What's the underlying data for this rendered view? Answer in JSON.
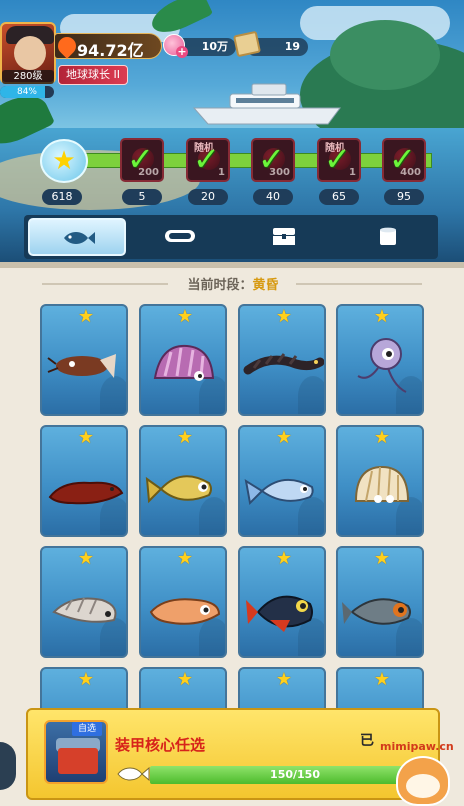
{
  "player": {
    "level": "280级",
    "exp_percent": "84%",
    "exp_fraction": 0.84,
    "power": "94.72亿",
    "title": "地球球长 II"
  },
  "resources": {
    "gems": "10万",
    "scrolls": "19"
  },
  "progress": {
    "current": "618",
    "milestones": [
      {
        "threshold": "200",
        "label": "5",
        "tag": ""
      },
      {
        "threshold": "1",
        "label": "20",
        "tag": "随机"
      },
      {
        "threshold": "300",
        "label": "40",
        "tag": ""
      },
      {
        "threshold": "1",
        "label": "65",
        "tag": "随机"
      },
      {
        "threshold": "400",
        "label": "95",
        "tag": ""
      }
    ]
  },
  "tabs": [
    {
      "icon": "fish-icon",
      "active": true
    },
    {
      "icon": "diving-mask-icon",
      "active": false
    },
    {
      "icon": "treasure-chest-icon",
      "active": false
    },
    {
      "icon": "can-icon",
      "active": false
    }
  ],
  "period": {
    "label": "当前时段：",
    "value": "黄昏"
  },
  "cards": [
    {
      "name": "shrimp-creature"
    },
    {
      "name": "purple-shell"
    },
    {
      "name": "dark-eel"
    },
    {
      "name": "purple-jellyfish"
    },
    {
      "name": "red-slug"
    },
    {
      "name": "yellow-fish"
    },
    {
      "name": "blue-fish"
    },
    {
      "name": "scallop-shell"
    },
    {
      "name": "spiral-shell"
    },
    {
      "name": "orange-squid"
    },
    {
      "name": "black-red-fish"
    },
    {
      "name": "grey-orange-fish"
    },
    {
      "name": "hidden-1"
    },
    {
      "name": "hidden-2"
    },
    {
      "name": "hidden-3"
    },
    {
      "name": "hidden-4"
    }
  ],
  "reward": {
    "tag": "自选",
    "title": "装甲核心任选",
    "count": "150/150",
    "fraction": 1.0,
    "side_label": "已"
  },
  "watermark": {
    "text": "mimipaw.cn"
  },
  "colors": {
    "accent_yellow": "#f4c62f",
    "title_red": "#d7231a",
    "progress_green": "#7dd13c",
    "card_blue": "#3f8fc6",
    "panel_bg": "#efe9dd"
  }
}
